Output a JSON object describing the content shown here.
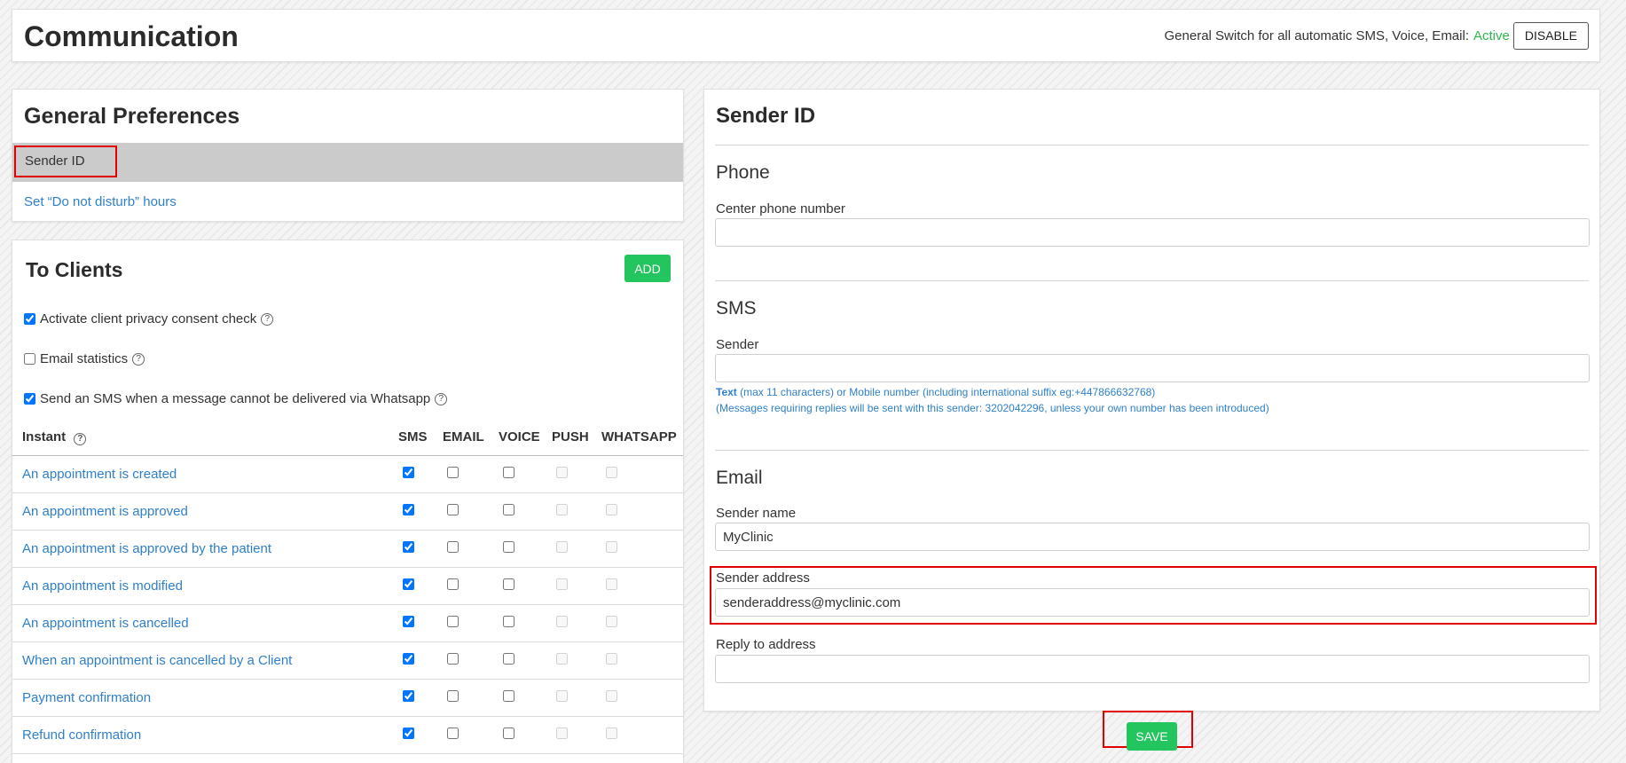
{
  "header": {
    "title": "Communication",
    "switch_label": "General Switch for all automatic SMS, Voice, Email:",
    "switch_status": "Active",
    "disable_label": "DISABLE"
  },
  "general_preferences": {
    "title": "General Preferences",
    "items": [
      {
        "label": "Sender ID",
        "selected": true
      },
      {
        "label": "Set “Do not disturb” hours"
      }
    ]
  },
  "to_clients": {
    "title": "To Clients",
    "add_label": "ADD",
    "options": [
      {
        "label": "Activate client privacy consent check",
        "checked": true
      },
      {
        "label": "Email statistics",
        "checked": false
      },
      {
        "label": "Send an SMS when a message cannot be delivered via Whatsapp",
        "checked": true
      }
    ],
    "table": {
      "columns": [
        "Instant",
        "SMS",
        "EMAIL",
        "VOICE",
        "PUSH",
        "WHATSAPP"
      ],
      "rows": [
        {
          "name": "An appointment is created",
          "sms": true
        },
        {
          "name": "An appointment is approved",
          "sms": true
        },
        {
          "name": "An appointment is approved by the patient",
          "sms": true
        },
        {
          "name": "An appointment is modified",
          "sms": true
        },
        {
          "name": "An appointment is cancelled",
          "sms": true
        },
        {
          "name": "When an appointment is cancelled by a Client",
          "sms": true
        },
        {
          "name": "Payment confirmation",
          "sms": true
        },
        {
          "name": "Refund confirmation",
          "sms": true
        }
      ]
    }
  },
  "sender_id": {
    "title": "Sender ID",
    "phone": {
      "section": "Phone",
      "label": "Center phone number",
      "value": ""
    },
    "sms": {
      "section": "SMS",
      "label": "Sender",
      "value": "",
      "hint_bold": "Text",
      "hint_rest": " (max 11 characters) or Mobile number (including international suffix eg:+447866632768)",
      "hint2": "(Messages requiring replies will be sent with this sender: 3202042296, unless your own number has been introduced)"
    },
    "email": {
      "section": "Email",
      "sender_name_label": "Sender name",
      "sender_name_value": "MyClinic",
      "sender_address_label": "Sender address",
      "sender_address_value": "senderaddress@myclinic.com",
      "reply_label": "Reply to address",
      "reply_value": ""
    }
  },
  "save_label": "SAVE",
  "colors": {
    "accent_green": "#22c55e",
    "link_blue": "#2f80c9",
    "status_active": "#2db84d",
    "highlight_red": "#e00000"
  }
}
